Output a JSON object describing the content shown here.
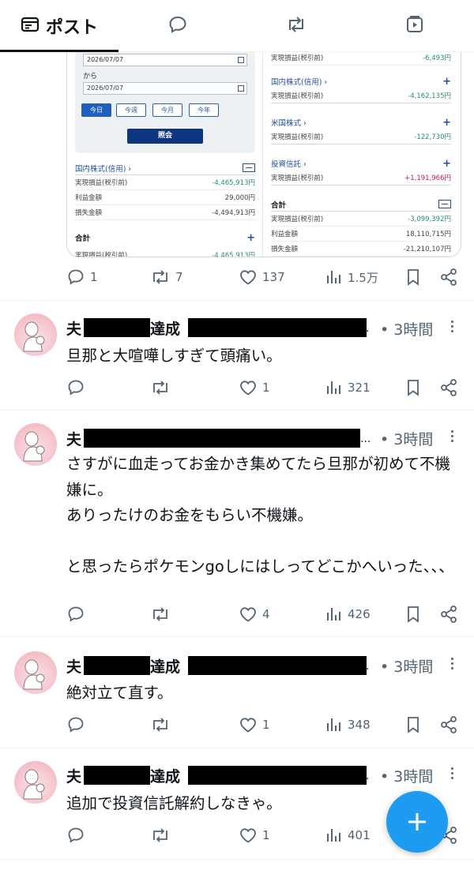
{
  "tabs": [
    {
      "label": "ポスト",
      "icon": "post-icon",
      "active": true
    },
    {
      "label": "",
      "icon": "reply-icon"
    },
    {
      "label": "",
      "icon": "retweet-icon"
    },
    {
      "label": "",
      "icon": "video-icon"
    }
  ],
  "embedded": {
    "date_from": "2026/07/07",
    "kara": "から",
    "date_to": "2026/07/07",
    "period_buttons": [
      "今日",
      "今週",
      "今月",
      "今年"
    ],
    "query_button": "照会",
    "left_section": {
      "title": "国内株式(信用) ›",
      "rows": [
        {
          "label": "実現損益(税引前)",
          "value": "-4,465,913円"
        },
        {
          "label": "利益金額",
          "value": "29,000円"
        },
        {
          "label": "損失金額",
          "value": "-4,494,913円"
        }
      ]
    },
    "left_total": {
      "title": "合計",
      "row_label": "実現損益(税引前)",
      "row_value": "-4,465,913円"
    },
    "right_top_row": {
      "label": "実現損益(税引前)",
      "value": "-6,493円"
    },
    "right_sections": [
      {
        "title": "国内株式(信用) ›",
        "label": "実現損益(税引前)",
        "value": "-4,162,135円"
      },
      {
        "title": "米国株式 ›",
        "label": "実現損益(税引前)",
        "value": "-122,730円"
      },
      {
        "title": "投資信託 ›",
        "label": "実現損益(税引前)",
        "value": "+1,191,966円"
      }
    ],
    "right_total": {
      "title": "合計",
      "rows": [
        {
          "label": "実現損益(税引前)",
          "value": "-3,099,392円"
        },
        {
          "label": "利益金額",
          "value": "18,110,715円"
        },
        {
          "label": "損失金額",
          "value": "-21,210,107円"
        }
      ]
    }
  },
  "first_post_stats": {
    "replies": "1",
    "retweets": "7",
    "likes": "137",
    "views": "1.5万"
  },
  "tweets": [
    {
      "name_a": "夫",
      "name_b": "達成",
      "time": "3時間",
      "text": "旦那と大喧嘩しすぎて頭痛い。",
      "replies": "",
      "retweets": "",
      "likes": "1",
      "views": "321"
    },
    {
      "name_a": "夫",
      "name_b": "",
      "time": "3時間",
      "text": "さすがに血走ってお金かき集めてたら旦那が初めて不機嫌に。\nありったけのお金をもらい不機嫌。\n\nと思ったらポケモンgoしにはしってどこかへいった、、、",
      "replies": "",
      "retweets": "",
      "likes": "4",
      "views": "426"
    },
    {
      "name_a": "夫",
      "name_b": "達成",
      "time": "3時間",
      "text": "絶対立て直す。",
      "replies": "",
      "retweets": "",
      "likes": "1",
      "views": "348"
    },
    {
      "name_a": "夫",
      "name_b": "達成",
      "time": "3時間",
      "text": "追加で投資信託解約しなきゃ。",
      "replies": "",
      "retweets": "",
      "likes": "1",
      "views": "401"
    }
  ],
  "colors": {
    "accent": "#1d9bf0",
    "text": "#0f1419",
    "muted": "#536471",
    "loss": "#2a8c6a",
    "gain": "#c2185b"
  }
}
